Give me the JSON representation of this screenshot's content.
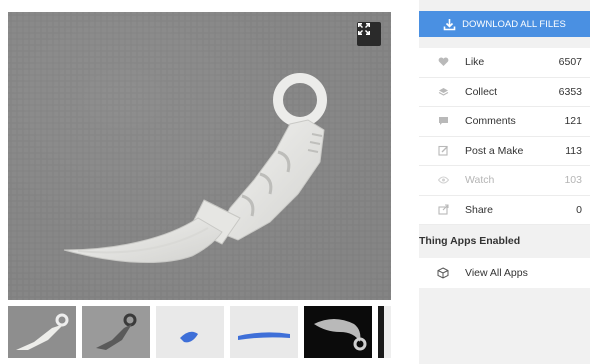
{
  "gallery": {
    "main_image": "karambit-knife-photo",
    "expand_icon": "expand-icon",
    "thumbnails": [
      {
        "name": "thumb-knife-white"
      },
      {
        "name": "thumb-knife-dark"
      },
      {
        "name": "thumb-blue-model-1"
      },
      {
        "name": "thumb-blue-model-2"
      },
      {
        "name": "thumb-knife-black-bg"
      },
      {
        "name": "thumb-partial"
      }
    ]
  },
  "sidebar": {
    "download_label": "DOWNLOAD ALL FILES",
    "download_color": "#4a90e2",
    "stats": [
      {
        "label": "Like",
        "count": "6507",
        "icon": "heart-icon"
      },
      {
        "label": "Collect",
        "count": "6353",
        "icon": "collect-icon"
      },
      {
        "label": "Comments",
        "count": "121",
        "icon": "comment-icon"
      },
      {
        "label": "Post a Make",
        "count": "113",
        "icon": "edit-icon"
      },
      {
        "label": "Watch",
        "count": "103",
        "icon": "eye-icon"
      },
      {
        "label": "Share",
        "count": "0",
        "icon": "share-icon"
      }
    ],
    "apps_title": "Thing Apps Enabled",
    "apps_item_label": "View All Apps",
    "apps_item_icon": "cube-icon"
  }
}
